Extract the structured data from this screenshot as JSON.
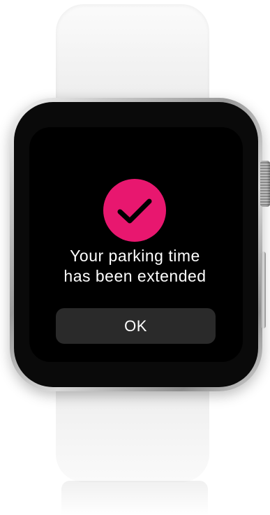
{
  "alert": {
    "message_line1": "Your parking time",
    "message_line2": "has been extended",
    "ok_label": "OK",
    "icon": "checkmark-icon"
  },
  "colors": {
    "accent": "#e8176f",
    "screen_background": "#000000",
    "button_background": "#2a2a2a",
    "text": "#ffffff",
    "band": "#f2f2f2"
  }
}
